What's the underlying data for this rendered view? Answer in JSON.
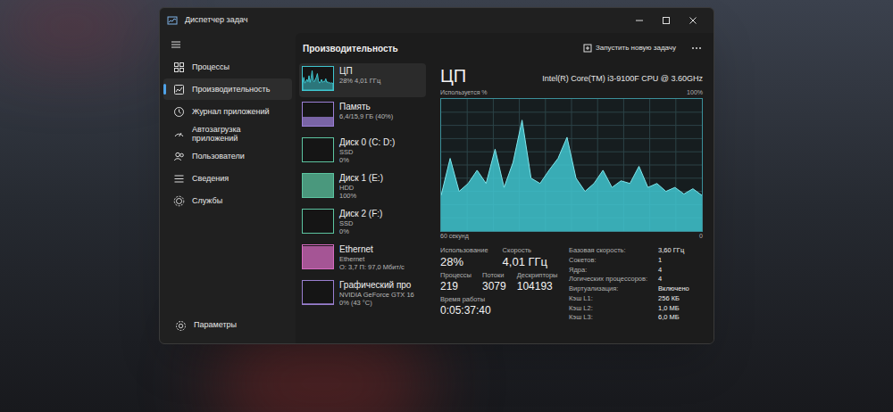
{
  "window": {
    "title": "Диспетчер задач"
  },
  "nav": {
    "items": [
      {
        "label": "Процессы",
        "selected": false
      },
      {
        "label": "Производительность",
        "selected": true
      },
      {
        "label": "Журнал приложений",
        "selected": false
      },
      {
        "label": "Автозагрузка приложений",
        "selected": false
      },
      {
        "label": "Пользователи",
        "selected": false
      },
      {
        "label": "Сведения",
        "selected": false
      },
      {
        "label": "Службы",
        "selected": false
      }
    ],
    "settings": "Параметры"
  },
  "header": {
    "title": "Производительность",
    "action": "Запустить новую задачу"
  },
  "devices": [
    {
      "name": "ЦП",
      "lines": [
        "28% 4,01 ГГц"
      ],
      "kind": "series",
      "color": "#3fc6d0",
      "selected": true
    },
    {
      "name": "Память",
      "lines": [
        "6,4/15,9 ГБ (40%)"
      ],
      "kind": "fill",
      "level": 0.4,
      "color": "#9b7fd6",
      "selected": false
    },
    {
      "name": "Диск 0 (C: D:)",
      "lines": [
        "SSD",
        "0%"
      ],
      "kind": "fill",
      "level": 0,
      "color": "#5cc4a0",
      "selected": false
    },
    {
      "name": "Диск 1 (E:)",
      "lines": [
        "HDD",
        "100%"
      ],
      "kind": "fill",
      "level": 1,
      "color": "#5cc4a0",
      "selected": false
    },
    {
      "name": "Диск 2 (F:)",
      "lines": [
        "SSD",
        "0%"
      ],
      "kind": "fill",
      "level": 0,
      "color": "#5cc4a0",
      "selected": false
    },
    {
      "name": "Ethernet",
      "lines": [
        "Ethernet",
        "О: 3,7 П: 97,0 Мбит/с"
      ],
      "kind": "fill",
      "level": 0.97,
      "color": "#d66bc0",
      "selected": false
    },
    {
      "name": "Графический про",
      "lines": [
        "NVIDIA GeForce GTX 16",
        "0% (43 °C)"
      ],
      "kind": "fill",
      "level": 0.03,
      "color": "#9a7fd0",
      "selected": false
    }
  ],
  "detail": {
    "title": "ЦП",
    "model": "Intel(R) Core(TM) i3-9100F CPU @ 3.60GHz",
    "axis_label": "Используется %",
    "axis_max": "100%",
    "axis_span": "60 секунд",
    "axis_min": "0",
    "series": [
      27,
      55,
      30,
      36,
      46,
      36,
      62,
      33,
      52,
      84,
      40,
      36,
      46,
      55,
      71,
      40,
      30,
      36,
      46,
      33,
      38,
      36,
      49,
      33,
      36,
      30,
      33,
      28,
      32,
      27
    ]
  },
  "stats": [
    {
      "label": "Использование",
      "value": "28%"
    },
    {
      "label": "Скорость",
      "value": "4,01 ГГц"
    }
  ],
  "counts": [
    {
      "label": "Процессы",
      "value": "219"
    },
    {
      "label": "Потоки",
      "value": "3079"
    },
    {
      "label": "Дескрипторы",
      "value": "104193"
    }
  ],
  "uptime": {
    "label": "Время работы",
    "value": "0:05:37:40"
  },
  "specs": [
    {
      "label": "Базовая скорость:",
      "value": "3,60 ГГц"
    },
    {
      "label": "Сокетов:",
      "value": "1"
    },
    {
      "label": "Ядра:",
      "value": "4"
    },
    {
      "label": "Логических процессоров:",
      "value": "4"
    },
    {
      "label": "Виртуализация:",
      "value": "Включено"
    },
    {
      "label": "Кэш L1:",
      "value": "256 КБ"
    },
    {
      "label": "Кэш L2:",
      "value": "1,0 МБ"
    },
    {
      "label": "Кэш L3:",
      "value": "6,0 МБ"
    }
  ]
}
